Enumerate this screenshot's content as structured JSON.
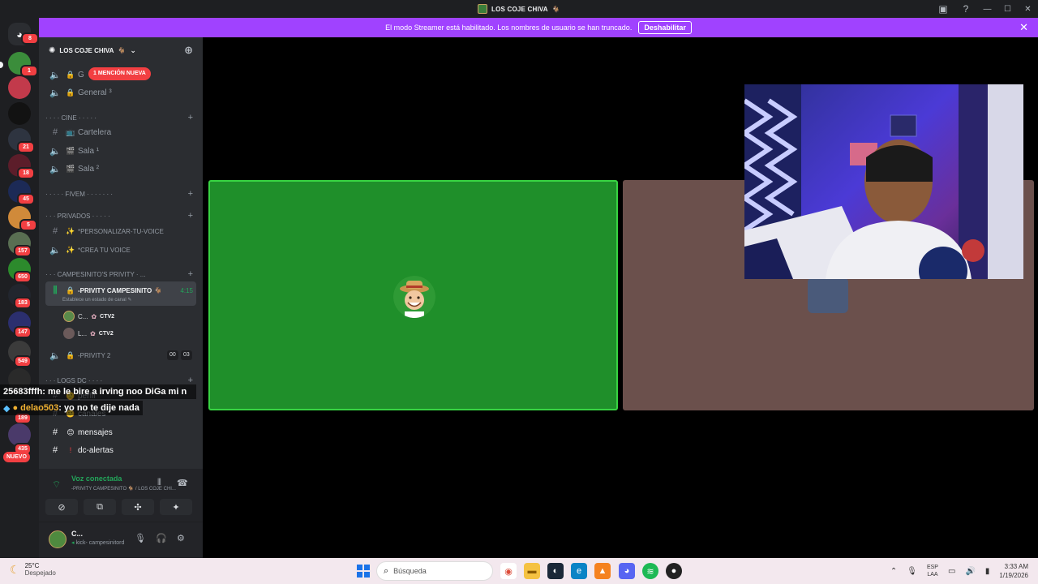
{
  "window": {
    "title": "LOS COJE CHIVA",
    "title_emoji": "🐐"
  },
  "banner": {
    "message": "El modo Streamer está habilitado. Los nombres de usuario se han truncado.",
    "button": "Deshabilitar",
    "color": "#a042ff"
  },
  "rail": {
    "home_badge": "8",
    "servers": [
      {
        "badge": "1"
      },
      {
        "badge": ""
      },
      {
        "badge": ""
      },
      {
        "badge": "21"
      },
      {
        "badge": "18"
      },
      {
        "badge": "45"
      },
      {
        "badge": "5"
      },
      {
        "badge": "157"
      },
      {
        "badge": "650"
      },
      {
        "badge": "183"
      },
      {
        "badge": "147"
      },
      {
        "badge": "549"
      },
      {
        "badge": "189"
      },
      {
        "badge": "435"
      }
    ],
    "new_label": "NUEVO"
  },
  "sidebar": {
    "guild_name": "LOS COJE CHIVA",
    "mention_label": "1 MENCIÓN NUEVA",
    "ch_g": "G",
    "ch_general": "General ³",
    "cat_cine": "· · · · CINE · · · · ·",
    "ch_cartelera": "Cartelera",
    "ch_sala1": "Sala ¹",
    "ch_sala2": "Sala ²",
    "cat_fivem": "· · · · · FIVEM · · · · · · ·",
    "cat_privados": "· · · PRIVADOS · · · · ·",
    "ch_personalizar": "*PERSONALIZAR-TU-VOICE",
    "ch_crea": "*CREA TU VOICE",
    "cat_campesinito": "· · · CAMPESINITO'S PRIVITY · ...",
    "active_channel": "-PRIVITY CAMPESINITO",
    "active_time": "4:15",
    "active_status": "Establece un estado de canal",
    "voice_users": [
      {
        "name": "C...",
        "tag": "CTV2"
      },
      {
        "name": "L...",
        "tag": "CTV2"
      }
    ],
    "ch_privity2": "-PRIVITY 2",
    "privity2_count_a": "00",
    "privity2_count_b": "03",
    "cat_logs": "· · · LOGS DC · · · ·",
    "ch_perfil": "perfil",
    "ch_canales": "canales",
    "ch_mensajes": "mensajes",
    "ch_alertas": "dc-alertas"
  },
  "overlay_chat": [
    {
      "user": "25683fffh",
      "text": ": me le bire a irving noo DiGa mi n"
    },
    {
      "user": "delao503",
      "text": ": yo no te dije nada"
    }
  ],
  "voice_panel": {
    "status": "Voz conectada",
    "subtitle": "-PRIVITY CAMPESINITO 🐐 / LOS COJE CHI..."
  },
  "user_panel": {
    "name": "C...",
    "sub": "kick- campesinitord"
  },
  "taskbar": {
    "temp": "25°C",
    "weather": "Despejado",
    "search": "Búsqueda",
    "lang1": "ESP",
    "lang2": "LAA",
    "time": "3:33 AM",
    "date": "1/19/2026"
  }
}
